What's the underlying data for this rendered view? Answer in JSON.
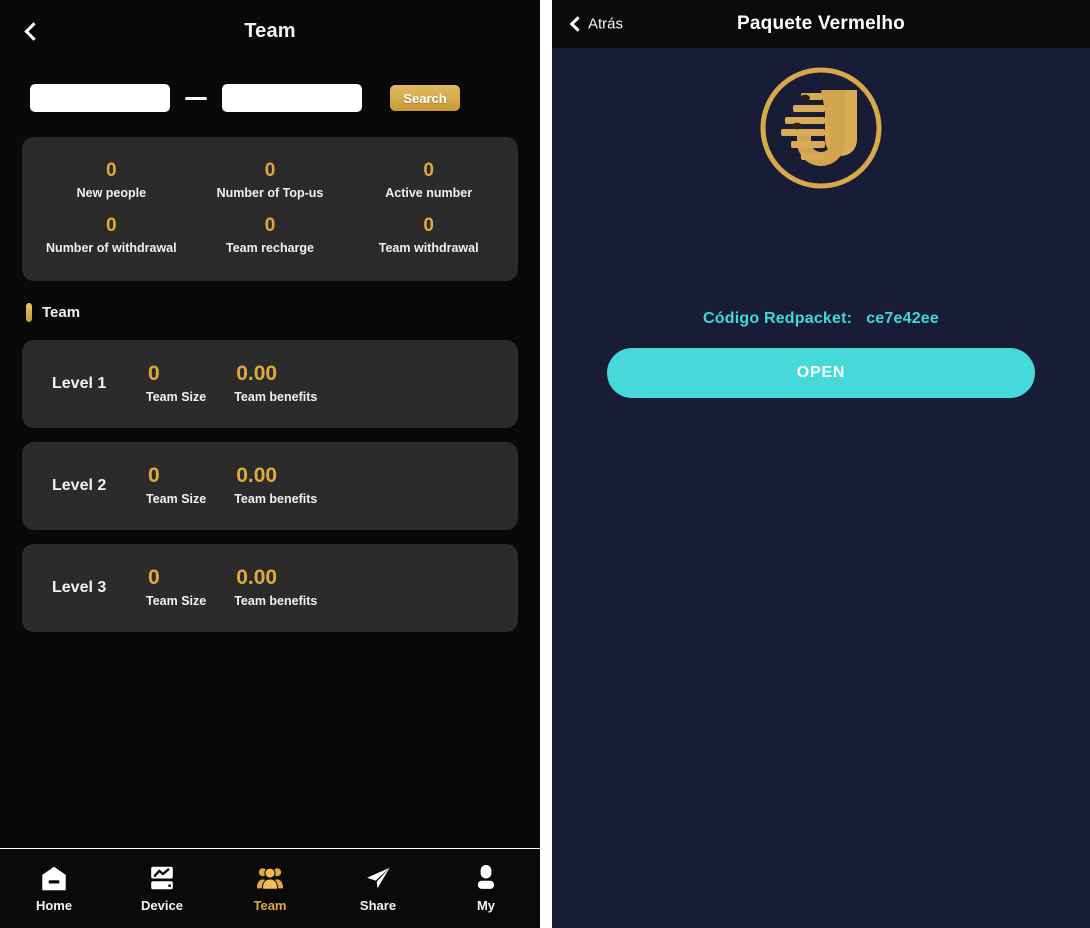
{
  "left_panel": {
    "header": {
      "back_icon": "chevron-left-icon",
      "title": "Team"
    },
    "search": {
      "from_value": "",
      "from_placeholder": "",
      "separator": "—",
      "to_value": "",
      "to_placeholder": "",
      "button_label": "Search"
    },
    "stats": [
      {
        "value": "0",
        "label": "New people"
      },
      {
        "value": "0",
        "label": "Number of Top-us"
      },
      {
        "value": "0",
        "label": "Active number"
      },
      {
        "value": "0",
        "label": "Number of withdrawal"
      },
      {
        "value": "0",
        "label": "Team recharge"
      },
      {
        "value": "0",
        "label": "Team withdrawal"
      }
    ],
    "section": {
      "title": "Team"
    },
    "levels": [
      {
        "name": "Level 1",
        "size_value": "0",
        "size_label": "Team Size",
        "benefit_value": "0.00",
        "benefit_label": "Team benefits"
      },
      {
        "name": "Level 2",
        "size_value": "0",
        "size_label": "Team Size",
        "benefit_value": "0.00",
        "benefit_label": "Team benefits"
      },
      {
        "name": "Level 3",
        "size_value": "0",
        "size_label": "Team Size",
        "benefit_value": "0.00",
        "benefit_label": "Team benefits"
      }
    ],
    "tabbar": [
      {
        "label": "Home",
        "icon": "home-icon",
        "active": false
      },
      {
        "label": "Device",
        "icon": "monitor-icon",
        "active": false
      },
      {
        "label": "Team",
        "icon": "people-icon",
        "active": true
      },
      {
        "label": "Share",
        "icon": "send-icon",
        "active": false
      },
      {
        "label": "My",
        "icon": "person-icon",
        "active": false
      }
    ]
  },
  "right_panel": {
    "header": {
      "back_icon": "chevron-left-icon",
      "back_label": "Atrás",
      "title": "Paquete Vermelho"
    },
    "logo_icon": "brand-u-logo-icon",
    "code_label": "Código Redpacket:",
    "code_value": "ce7e42ee",
    "open_button_label": "OPEN"
  },
  "colors": {
    "gold": "#e0a93c",
    "cyan": "#45d9da",
    "card": "#2b2b2b",
    "left_bg": "#090909",
    "right_bg": "#181c36"
  }
}
